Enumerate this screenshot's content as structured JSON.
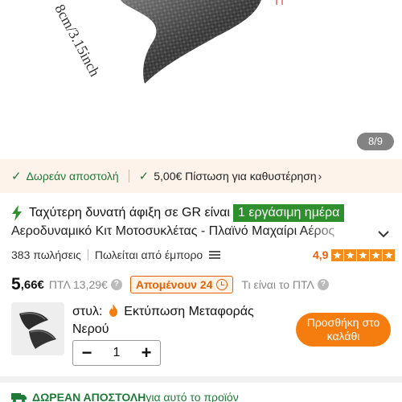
{
  "hero": {
    "dimension_text": "8cm/3.15inch",
    "page_indicator": "8/9"
  },
  "benefits": {
    "free_shipping": "Δωρεάν αποστολή",
    "credit": "5,00€ Πίστωση για καθυστέρηση"
  },
  "delivery": {
    "prefix": "Ταχύτερη δυνατή άφιξη σε GR είναι",
    "highlight": "1 εργάσιμη ημέρα"
  },
  "product": {
    "title": "Αεροδυναμικό Κιτ Μοτοσυκλέτας - Πλαϊνό Μαχαίρι Αέρος",
    "sales": "383 πωλήσεις",
    "sold_by": "Πωλείται από έμπορο",
    "rating": "4,9",
    "stars": 5
  },
  "price": {
    "main": "5",
    "decimals": ",66€",
    "rrp": "ΠΤΛ 13,29€",
    "remaining": "Απομένουν 24",
    "rrp_question": "Τι είναι το ΠΤΛ"
  },
  "variant": {
    "style_prefix": "στυλ:",
    "style_value": "Εκτύπωση Μεταφοράς Νερού"
  },
  "cart": {
    "add_label": "Προσθήκη στο καλάθι",
    "quantity": "1",
    "minus": "−",
    "plus": "+"
  },
  "free_shipping_bar": {
    "strong": "ΔΩΡΕΑΝ ΑΠΟΣΤΟΛΗ",
    "rest": "για αυτό το προϊόν"
  },
  "colors": {
    "accent_orange": "#f57c0e",
    "green": "#2f8f2f",
    "benefit_bg": "#fdf3ea"
  }
}
